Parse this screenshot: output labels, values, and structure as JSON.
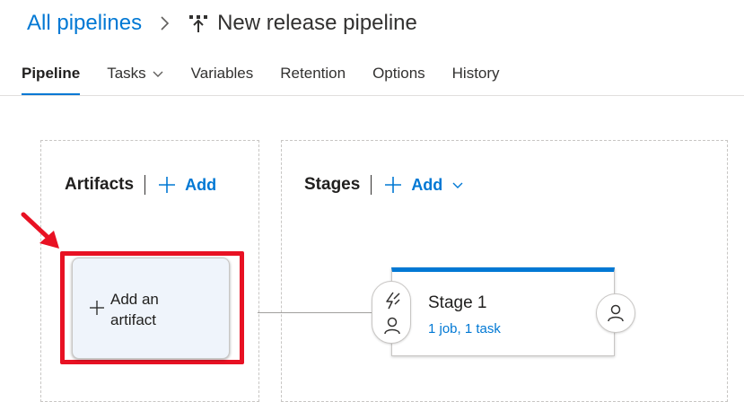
{
  "breadcrumb": {
    "root_label": "All pipelines",
    "title": "New release pipeline"
  },
  "tabs": [
    {
      "label": "Pipeline",
      "active": true
    },
    {
      "label": "Tasks",
      "has_dropdown": true
    },
    {
      "label": "Variables"
    },
    {
      "label": "Retention"
    },
    {
      "label": "Options"
    },
    {
      "label": "History"
    }
  ],
  "artifacts": {
    "title": "Artifacts",
    "add_label": "Add",
    "card_label_line1": "Add an",
    "card_label_line2": "artifact"
  },
  "stages": {
    "title": "Stages",
    "add_label": "Add",
    "items": [
      {
        "name": "Stage 1",
        "summary": "1 job, 1 task"
      }
    ]
  },
  "colors": {
    "accent": "#0078d4",
    "highlight": "#e81123"
  },
  "icons": {
    "breadcrumb_separator": "chevron-right-icon",
    "pipeline": "release-pipeline-icon",
    "add": "plus-icon",
    "pre_deployment_trigger": "lightning-icon",
    "pre_deployment_approver": "person-icon",
    "post_deployment_approver": "person-icon",
    "annotation": "red-arrow-icon"
  }
}
